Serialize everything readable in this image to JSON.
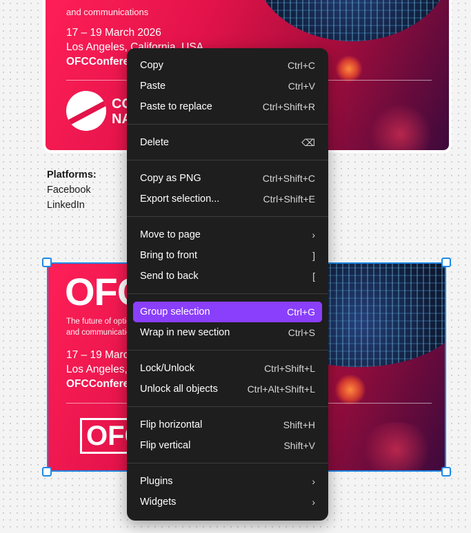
{
  "canvas": {
    "top_frame": {
      "tagline": "and communications",
      "date": "17 – 19 March 2026",
      "location": "Los Angeles, California, USA",
      "url": "OFCConference.org",
      "logo_text_1": "CO",
      "logo_text_2": "NA"
    },
    "platforms": {
      "heading": "Platforms:",
      "items": [
        "Facebook",
        "LinkedIn"
      ]
    },
    "bottom_frame": {
      "logo_big": "OFC",
      "tagline_1": "The future of optical networking",
      "tagline_2": "and communications",
      "date": "17 – 19 March 2026",
      "location": "Los Angeles, California, USA",
      "url": "OFCConference.org",
      "logo_box": "OFC"
    }
  },
  "context_menu": {
    "groups": [
      [
        {
          "label": "Copy",
          "shortcut": "Ctrl+C"
        },
        {
          "label": "Paste",
          "shortcut": "Ctrl+V"
        },
        {
          "label": "Paste to replace",
          "shortcut": "Ctrl+Shift+R"
        }
      ],
      [
        {
          "label": "Delete",
          "shortcut": "⌫"
        }
      ],
      [
        {
          "label": "Copy as PNG",
          "shortcut": "Ctrl+Shift+C"
        },
        {
          "label": "Export selection...",
          "shortcut": "Ctrl+Shift+E"
        }
      ],
      [
        {
          "label": "Move to page",
          "shortcut": "›"
        },
        {
          "label": "Bring to front",
          "shortcut": "]"
        },
        {
          "label": "Send to back",
          "shortcut": "["
        }
      ],
      [
        {
          "label": "Group selection",
          "shortcut": "Ctrl+G",
          "active": true
        },
        {
          "label": "Wrap in new section",
          "shortcut": "Ctrl+S"
        }
      ],
      [
        {
          "label": "Lock/Unlock",
          "shortcut": "Ctrl+Shift+L"
        },
        {
          "label": "Unlock all objects",
          "shortcut": "Ctrl+Alt+Shift+L"
        }
      ],
      [
        {
          "label": "Flip horizontal",
          "shortcut": "Shift+H"
        },
        {
          "label": "Flip vertical",
          "shortcut": "Shift+V"
        }
      ],
      [
        {
          "label": "Plugins",
          "shortcut": "›"
        },
        {
          "label": "Widgets",
          "shortcut": "›"
        }
      ]
    ]
  },
  "colors": {
    "menu_bg": "#1e1e1e",
    "highlight": "#8a3ffc",
    "selection": "#1e88e5",
    "brand_red": "#e3134a"
  }
}
